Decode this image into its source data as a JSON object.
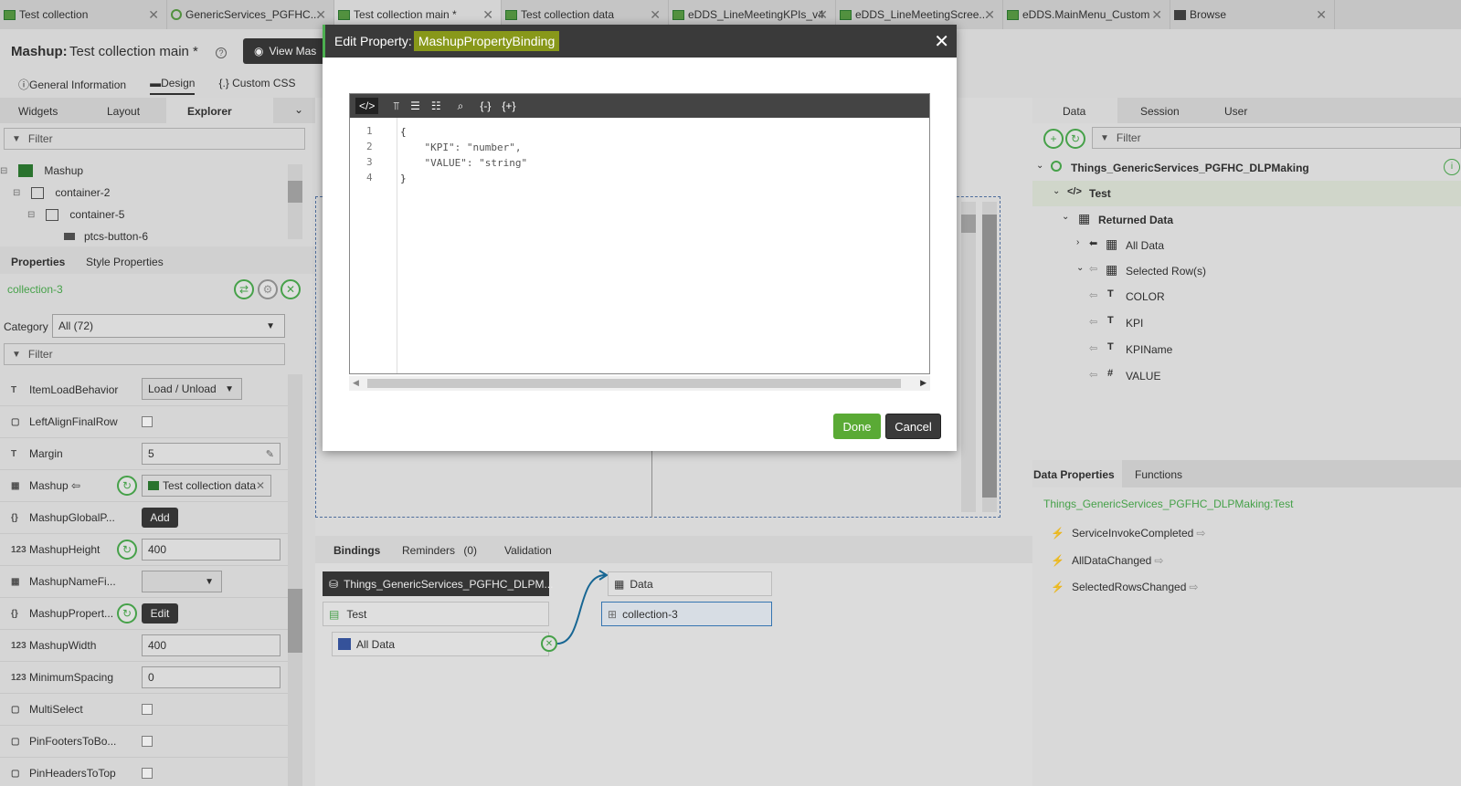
{
  "tabs": [
    {
      "label": "Test collection",
      "icon": "table-icon"
    },
    {
      "label": "GenericServices_PGFHC...",
      "icon": "thing-icon"
    },
    {
      "label": "Test collection main *",
      "icon": "table-icon"
    },
    {
      "label": "Test collection data",
      "icon": "table-icon"
    },
    {
      "label": "eDDS_LineMeetingKPIs_v4",
      "icon": "table-icon"
    },
    {
      "label": "eDDS_LineMeetingScree...",
      "icon": "table-icon"
    },
    {
      "label": "eDDS.MainMenu_Custom",
      "icon": "table-icon"
    },
    {
      "label": "Browse",
      "icon": "folder-icon"
    }
  ],
  "header": {
    "prefix": "Mashup:",
    "title": "Test collection main *",
    "view_button": "View Mas"
  },
  "subtabs": [
    "General Information",
    "Design",
    "Custom CSS"
  ],
  "left_panel": {
    "tabs": [
      "Widgets",
      "Layout",
      "Explorer"
    ],
    "filter_placeholder": "Filter",
    "tree": [
      "Mashup",
      "container-2",
      "container-5",
      "ptcs-button-6"
    ],
    "prop_tabs": [
      "Properties",
      "Style Properties"
    ],
    "selected": "collection-3",
    "category_label": "Category",
    "category_value": "All (72)",
    "prop_filter": "Filter",
    "properties": [
      {
        "name": "ItemLoadBehavior",
        "icon": "T",
        "value": "Load / Unload",
        "kind": "select"
      },
      {
        "name": "LeftAlignFinalRow",
        "icon": "▢",
        "kind": "check"
      },
      {
        "name": "Margin",
        "icon": "T",
        "value": "5",
        "kind": "text"
      },
      {
        "name": "Mashup ⇦",
        "icon": "▦",
        "value": "Test collection data",
        "kind": "mashup"
      },
      {
        "name": "MashupGlobalP...",
        "icon": "{}",
        "value": "Add",
        "kind": "button"
      },
      {
        "name": "MashupHeight",
        "icon": "123",
        "value": "400",
        "kind": "num"
      },
      {
        "name": "MashupNameFi...",
        "icon": "▦",
        "kind": "select2"
      },
      {
        "name": "MashupPropert...",
        "icon": "{}",
        "value": "Edit",
        "kind": "button2"
      },
      {
        "name": "MashupWidth",
        "icon": "123",
        "value": "400",
        "kind": "text"
      },
      {
        "name": "MinimumSpacing",
        "icon": "123",
        "value": "0",
        "kind": "text"
      },
      {
        "name": "MultiSelect",
        "icon": "▢",
        "kind": "check"
      },
      {
        "name": "PinFootersToBo...",
        "icon": "▢",
        "kind": "check"
      },
      {
        "name": "PinHeadersToTop",
        "icon": "▢",
        "kind": "check"
      }
    ]
  },
  "bindings": {
    "tabs": [
      "Bindings",
      "Reminders",
      "(0)",
      "Validation"
    ],
    "source": "Things_GenericServices_PGFHC_DLPM...",
    "service": "Test",
    "all_data": "All Data",
    "target_data": "Data",
    "target_widget": "collection-3"
  },
  "right_panel": {
    "tabs": [
      "Data",
      "Session",
      "User"
    ],
    "filter_placeholder": "Filter",
    "tree": [
      {
        "label": "Things_GenericServices_PGFHC_DLPMaking",
        "bold": true
      },
      {
        "label": "Test",
        "bold": true
      },
      {
        "label": "Returned Data",
        "bold": true
      },
      {
        "label": "All Data",
        "bold": false
      },
      {
        "label": "Selected Row(s)",
        "bold": false
      },
      {
        "label": "COLOR",
        "bold": false
      },
      {
        "label": "KPI",
        "bold": false
      },
      {
        "label": "KPIName",
        "bold": false
      },
      {
        "label": "VALUE",
        "bold": false
      }
    ],
    "lower_tabs": [
      "Data Properties",
      "Functions"
    ],
    "path": "Things_GenericServices_PGFHC_DLPMaking:Test",
    "events": [
      "ServiceInvokeCompleted",
      "AllDataChanged",
      "SelectedRowsChanged"
    ]
  },
  "modal": {
    "title_prefix": "Edit Property:",
    "title_name": "MashupPropertyBinding",
    "line_numbers": [
      "1",
      "2",
      "3",
      "4"
    ],
    "code": [
      "{",
      "    \"KPI\": \"number\",",
      "    \"VALUE\": \"string\"",
      "}"
    ],
    "done": "Done",
    "cancel": "Cancel"
  },
  "colors": {
    "accent_green": "#4caf50",
    "dark": "#3a3a3a",
    "highlight": "#c8e600"
  }
}
